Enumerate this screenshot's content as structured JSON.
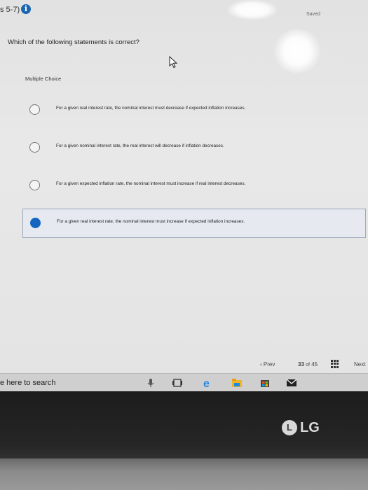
{
  "header": {
    "section_text": "s 5-7)",
    "info_icon": "i",
    "saved_label": "Saved"
  },
  "question": {
    "text": "Which of the following statements is correct?"
  },
  "multiple_choice": {
    "label": "Multiple Choice",
    "options": [
      {
        "text": "For a given real interest rate, the nominal interest must decrease if expected inflation increases.",
        "selected": false
      },
      {
        "text": "For a given nominal interest rate, the real interest will decrease if inflation decreases.",
        "selected": false
      },
      {
        "text": "For a given expected inflation rate, the nominal interest must increase if real interest decreases.",
        "selected": false
      },
      {
        "text": "For a given real interest rate, the nominal interest must increase if expected inflation increases.",
        "selected": true
      }
    ]
  },
  "pager": {
    "prev_label": "Prev",
    "current": "33",
    "of_label": "of",
    "total": "45",
    "next_label": "Next"
  },
  "taskbar": {
    "search_placeholder": "e here to search"
  },
  "bezel": {
    "brand": "LG",
    "brand_icon": "L"
  },
  "colors": {
    "radio_selected": "#1565c0",
    "info_icon": "#1a66b3"
  }
}
